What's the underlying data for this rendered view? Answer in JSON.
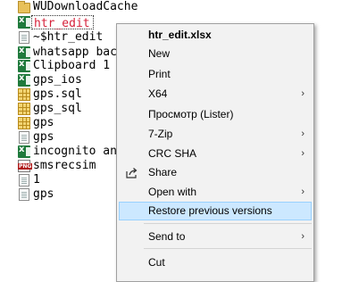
{
  "files": [
    {
      "name": "WUDownloadCache",
      "icon": "folder-icon"
    },
    {
      "name": "htr_edit",
      "icon": "excel-file-icon",
      "selected": true
    },
    {
      "name": "~$htr_edit",
      "icon": "document-file-icon"
    },
    {
      "name": "whatsapp backup",
      "icon": "excel-file-icon"
    },
    {
      "name": "Clipboard 1",
      "icon": "excel-file-icon"
    },
    {
      "name": "gps_ios",
      "icon": "excel-file-icon"
    },
    {
      "name": "gps.sql",
      "icon": "database-file-icon"
    },
    {
      "name": "gps_sql",
      "icon": "database-file-icon"
    },
    {
      "name": "gps",
      "icon": "database-file-icon"
    },
    {
      "name": "gps",
      "icon": "document-file-icon"
    },
    {
      "name": "incognito analysis",
      "icon": "excel-file-icon"
    },
    {
      "name": "smsrecsim",
      "icon": "png-file-icon"
    },
    {
      "name": "1",
      "icon": "document-file-icon"
    },
    {
      "name": "gps",
      "icon": "document-file-icon"
    }
  ],
  "context_menu": {
    "title": "htr_edit.xlsx",
    "items": [
      {
        "label": "New"
      },
      {
        "label": "Print"
      },
      {
        "label": "X64",
        "submenu": true
      },
      {
        "label": "Просмотр (Lister)"
      },
      {
        "label": "7-Zip",
        "submenu": true
      },
      {
        "label": "CRC SHA",
        "submenu": true
      },
      {
        "label": "Share",
        "icon": "share-icon"
      },
      {
        "label": "Open with",
        "submenu": true
      },
      {
        "label": "Restore previous versions",
        "highlighted": true
      },
      {
        "label": "Send to",
        "submenu": true
      },
      {
        "label": "Cut"
      }
    ]
  },
  "colors": {
    "selected_text": "#d6213a",
    "menu_background": "#f2f2f2",
    "highlight": "#cce8ff"
  }
}
